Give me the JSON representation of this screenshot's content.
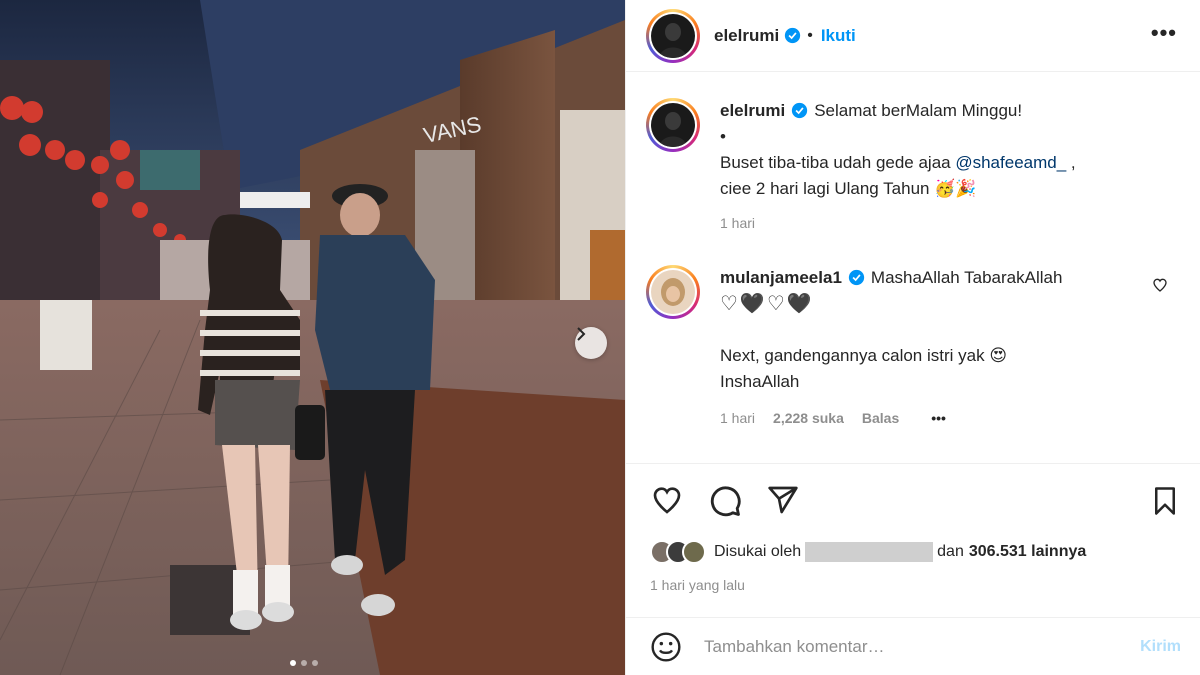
{
  "post": {
    "author": "elelrumi",
    "follow_label": "Ikuti",
    "more_label": "•••"
  },
  "caption": {
    "username": "elelrumi",
    "line1": "Selamat berMalam Minggu!",
    "line2": "•",
    "line3_prefix": "Buset tiba-tiba udah gede ajaa ",
    "mention": "@shafeeamd_",
    "line3_suffix": " ,",
    "line4": "ciee 2 hari lagi Ulang Tahun 🥳🎉",
    "time": "1 hari"
  },
  "comment": {
    "username": "mulanjameela1",
    "line1": "MashaAllah TabarakAllah",
    "line2": "♡🖤♡🖤",
    "line3": "Next, gandengannya calon istri yak 😍",
    "line4": "InshaAllah",
    "time": "1 hari",
    "likes": "2,228 suka",
    "reply": "Balas",
    "more": "•••"
  },
  "likes_bar": {
    "prefix": "Disukai oleh",
    "and": "dan",
    "count": "306.531 lainnya"
  },
  "posted_time": "1 hari yang lalu",
  "composer": {
    "placeholder": "Tambahkan komentar…",
    "post_label": "Kirim"
  },
  "icons": {
    "like": "heart-icon",
    "comment": "comment-icon",
    "share": "paper-plane-icon",
    "save": "bookmark-icon",
    "emoji": "emoji-icon",
    "verified": "verified-badge-icon",
    "next": "chevron-right-icon"
  },
  "colors": {
    "accent": "#0095f6",
    "mention": "#00376b",
    "muted": "#8e8e8e",
    "verified": "#0095f6"
  },
  "carousel": {
    "slides": 3,
    "current": 1
  }
}
